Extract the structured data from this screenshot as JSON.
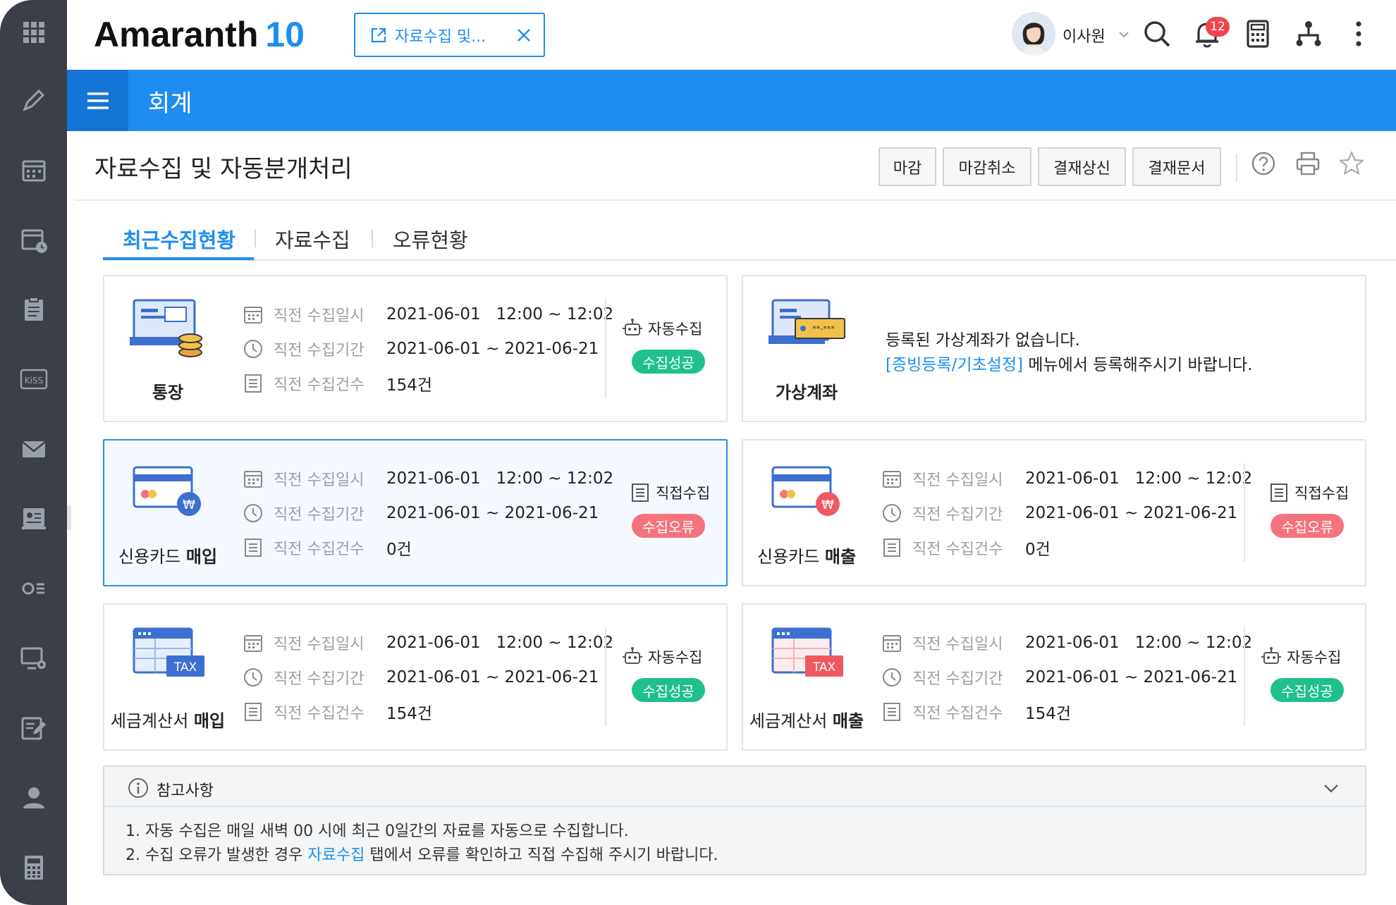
{
  "app": {
    "logo_text": "Amaranth",
    "logo_version": "10",
    "brand_color": "#1e8ef0"
  },
  "header": {
    "open_tab_label": "자료수집 및...",
    "user_name": "이사원",
    "notification_count": "12"
  },
  "module": {
    "title": "회계"
  },
  "page": {
    "title": "자료수집 및 자동분개처리",
    "buttons": [
      "마감",
      "마감취소",
      "결재상신",
      "결재문서"
    ]
  },
  "tabs": [
    "최근수집현황",
    "자료수집",
    "오류현황"
  ],
  "labels": {
    "last_datetime": "직전 수집일시",
    "last_period": "직전 수집기간",
    "last_count": "직전 수집건수"
  },
  "cards": [
    {
      "name": "통장",
      "bold": "",
      "date": "2021-06-01",
      "time": "12:00 ~ 12:02",
      "period": "2021-06-01 ~ 2021-06-21",
      "count": "154건",
      "mode": "자동수집",
      "status": "수집성공",
      "icon": "bankbook-icon"
    },
    {
      "name": "가상계좌",
      "message1": "등록된 가상계좌가 없습니다.",
      "link": "[증빙등록/기초설정]",
      "message2": " 메뉴에서 등록해주시기 바랍니다.",
      "icon": "virtual-account-icon"
    },
    {
      "name": "신용카드 ",
      "bold": "매입",
      "date": "2021-06-01",
      "time": "12:00 ~ 12:02",
      "period": "2021-06-01 ~ 2021-06-21",
      "count": "0건",
      "mode": "직접수집",
      "status": "수집오류",
      "icon": "credit-card-purchase-icon"
    },
    {
      "name": "신용카드 ",
      "bold": "매출",
      "date": "2021-06-01",
      "time": "12:00 ~ 12:02",
      "period": "2021-06-01 ~ 2021-06-21",
      "count": "0건",
      "mode": "직접수집",
      "status": "수집오류",
      "icon": "credit-card-sales-icon"
    },
    {
      "name": "세금계산서 ",
      "bold": "매입",
      "date": "2021-06-01",
      "time": "12:00 ~ 12:02",
      "period": "2021-06-01 ~ 2021-06-21",
      "count": "154건",
      "mode": "자동수집",
      "status": "수집성공",
      "icon": "tax-invoice-purchase-icon",
      "tax_badge": "TAX"
    },
    {
      "name": "세금계산서 ",
      "bold": "매출",
      "date": "2021-06-01",
      "time": "12:00 ~ 12:02",
      "period": "2021-06-01 ~ 2021-06-21",
      "count": "154건",
      "mode": "자동수집",
      "status": "수집성공",
      "icon": "tax-invoice-sales-icon",
      "tax_badge": "TAX"
    }
  ],
  "notes": {
    "title": "참고사항",
    "line1": "1. 자동 수집은 매일 새벽 00 시에 최근 0일간의 자료를 자동으로 수집합니다.",
    "line2_a": "2. 수집 오류가 발생한 경우 ",
    "line2_link": "자료수집",
    "line2_b": " 탭에서 오류를 확인하고 직접 수집해 주시기 바랍니다."
  },
  "colors": {
    "success": "#1fc08e",
    "error": "#f5737c",
    "module_bar": "#1f8cf0",
    "rail": "#3b3f48"
  },
  "sidebar_icons": [
    "apps-grid-icon",
    "pen-icon",
    "calendar-icon",
    "calendar-clock-icon",
    "clipboard-icon",
    "kiss-icon",
    "mail-icon",
    "id-card-icon",
    "list-toggle-icon",
    "monitor-gear-icon",
    "edit-doc-icon",
    "user-icon",
    "calculator-icon"
  ]
}
